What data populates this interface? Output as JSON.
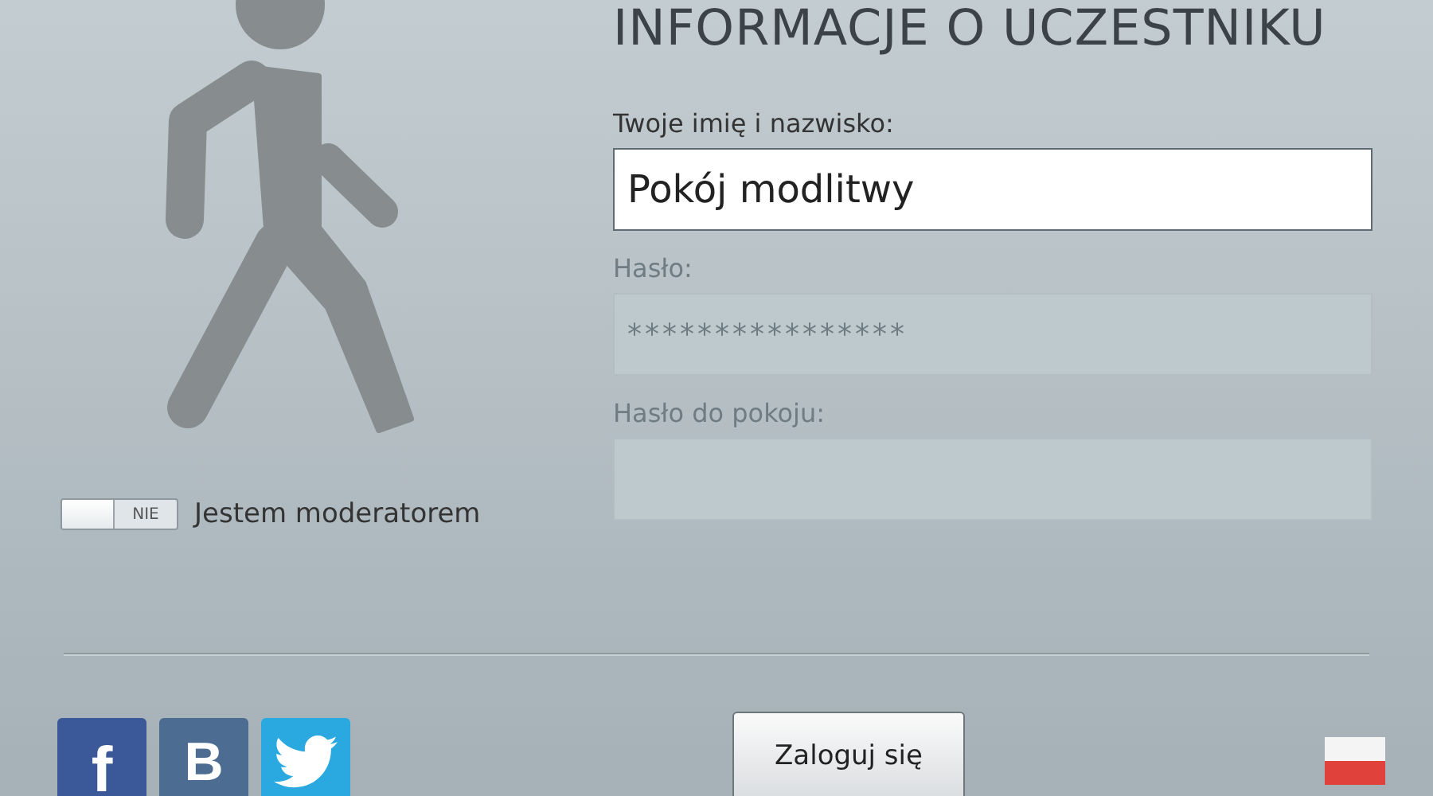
{
  "title": "INFORMACJE O UCZESTNIKU",
  "moderator_toggle": {
    "on": false,
    "off_label": "NIE",
    "label": "Jestem moderatorem"
  },
  "fields": [
    {
      "label": "Twoje imię i nazwisko:",
      "value": "Pokój modlitwy",
      "disabled": false
    },
    {
      "label": "Hasło:",
      "value": "****************",
      "disabled": true
    },
    {
      "label": "Hasło do pokoju:",
      "disabled": true
    }
  ],
  "social": [
    {
      "kind": "facebook",
      "glyph": "f"
    },
    {
      "kind": "vk",
      "glyph": "B"
    },
    {
      "kind": "twitter"
    }
  ],
  "login_button": "Zaloguj się"
}
